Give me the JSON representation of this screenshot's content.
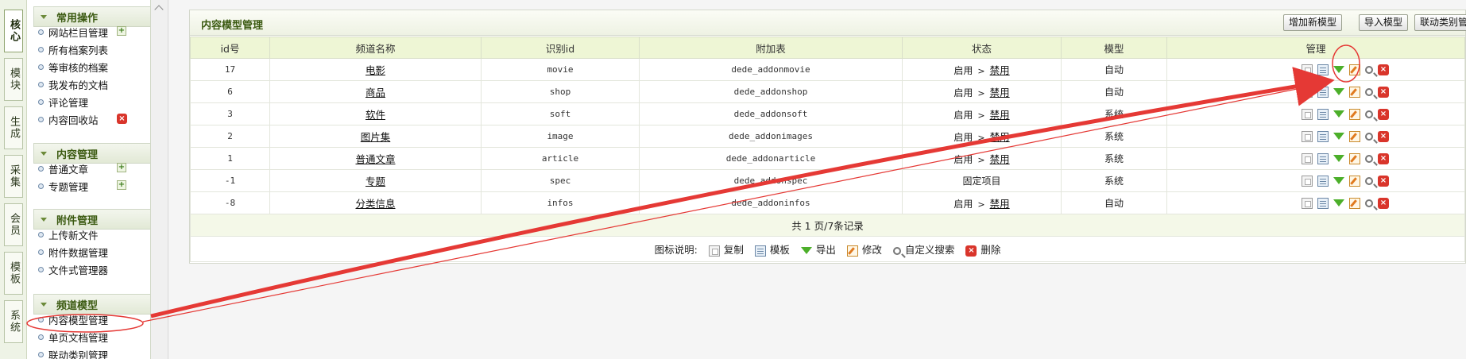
{
  "vertical_tabs": [
    "核心",
    "模块",
    "生成",
    "采集",
    "会员",
    "模板",
    "系统"
  ],
  "sidebar": {
    "sections": [
      {
        "title": "常用操作",
        "items": [
          {
            "label": "网站栏目管理",
            "add": true
          },
          {
            "label": "所有档案列表"
          },
          {
            "label": "等审核的档案"
          },
          {
            "label": "我发布的文档"
          },
          {
            "label": "评论管理"
          },
          {
            "label": "内容回收站",
            "delete": true
          }
        ]
      },
      {
        "title": "内容管理",
        "items": [
          {
            "label": "普通文章",
            "add": true
          },
          {
            "label": "专题管理",
            "add": true
          }
        ]
      },
      {
        "title": "附件管理",
        "items": [
          {
            "label": "上传新文件"
          },
          {
            "label": "附件数据管理"
          },
          {
            "label": "文件式管理器"
          }
        ]
      },
      {
        "title": "频道模型",
        "items": [
          {
            "label": "内容模型管理",
            "highlighted": true
          },
          {
            "label": "单页文档管理"
          },
          {
            "label": "联动类别管理"
          }
        ]
      }
    ]
  },
  "panel": {
    "title": "内容模型管理",
    "buttons": [
      "增加新模型",
      "导入模型",
      "联动类别管理"
    ],
    "columns": [
      "id号",
      "频道名称",
      "识别id",
      "附加表",
      "状态",
      "模型",
      "管理"
    ],
    "rows": [
      {
        "id": "17",
        "name": "电影",
        "nid": "movie",
        "table": "dede_addonmovie",
        "status": "启用",
        "disable": "禁用",
        "model": "自动"
      },
      {
        "id": "6",
        "name": "商品",
        "nid": "shop",
        "table": "dede_addonshop",
        "status": "启用",
        "disable": "禁用",
        "model": "自动"
      },
      {
        "id": "3",
        "name": "软件",
        "nid": "soft",
        "table": "dede_addonsoft",
        "status": "启用",
        "disable": "禁用",
        "model": "系统"
      },
      {
        "id": "2",
        "name": "图片集",
        "nid": "image",
        "table": "dede_addonimages",
        "status": "启用",
        "disable": "禁用",
        "model": "系统"
      },
      {
        "id": "1",
        "name": "普通文章",
        "nid": "article",
        "table": "dede_addonarticle",
        "status": "启用",
        "disable": "禁用",
        "model": "系统"
      },
      {
        "id": "-1",
        "name": "专题",
        "nid": "spec",
        "table": "dede_addonspec",
        "status": "固定项目",
        "disable": "",
        "model": "系统"
      },
      {
        "id": "-8",
        "name": "分类信息",
        "nid": "infos",
        "table": "dede_addoninfos",
        "status": "启用",
        "disable": "禁用",
        "model": "自动"
      }
    ],
    "actions": [
      "copy-icon",
      "template-icon",
      "export-icon",
      "edit-icon",
      "search-icon",
      "delete-icon"
    ],
    "status_arrow": ">",
    "pagination": "共 1 页/7条记录",
    "legend": {
      "label": "图标说明:",
      "items": [
        "复制",
        "模板",
        "导出",
        "修改",
        "自定义搜索",
        "删除"
      ]
    }
  },
  "colors": {
    "annotation": "#e53935",
    "section_title": "#3b5a11",
    "header_bg": "#eef6d5"
  }
}
